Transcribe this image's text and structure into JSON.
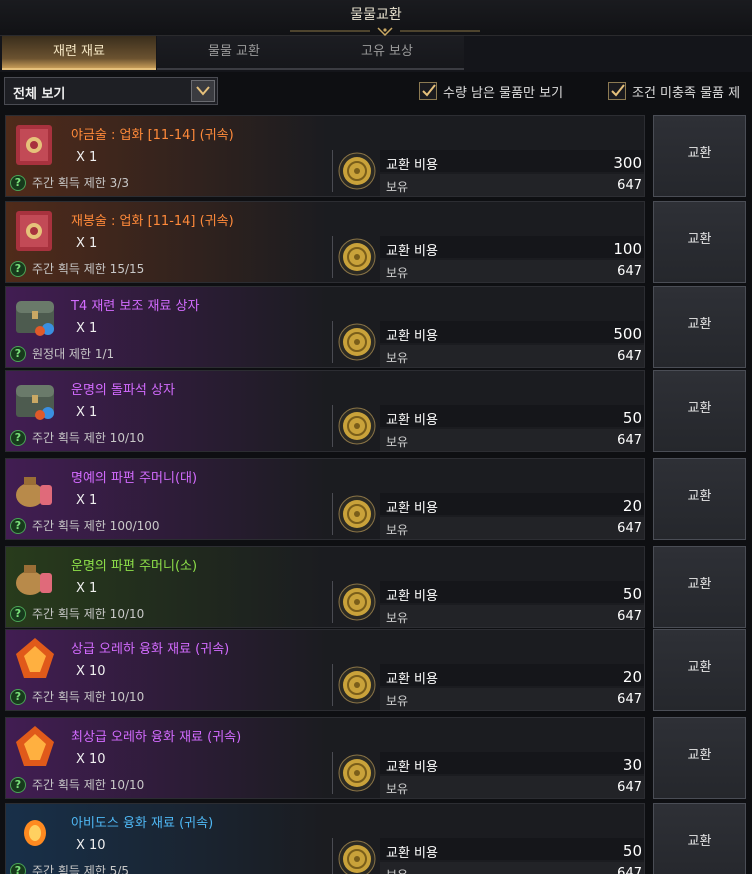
{
  "window": {
    "title": "물물교환"
  },
  "tabs": [
    {
      "label": "재련 재료",
      "active": true
    },
    {
      "label": "물물 교환",
      "active": false
    },
    {
      "label": "고유 보상",
      "active": false
    }
  ],
  "filter": {
    "dropdown_value": "전체 보기",
    "check_remaining": {
      "label": "수량 남은 물품만 보기",
      "checked": true
    },
    "check_unmet": {
      "label": "조건 미충족 물품 제",
      "checked": true
    }
  },
  "labels": {
    "cost": "교환 비용",
    "owned": "보유",
    "exchange": "교환"
  },
  "items": [
    {
      "name": "야금술 : 업화 [11-14] (귀속)",
      "grade": "orange",
      "qty": "X 1",
      "limit": "주간 획득 제한 3/3",
      "cost": "300",
      "owned": "647",
      "icon": "book-icon"
    },
    {
      "name": "재봉술 : 업화 [11-14] (귀속)",
      "grade": "orange",
      "qty": "X 1",
      "limit": "주간 획득 제한 15/15",
      "cost": "100",
      "owned": "647",
      "icon": "book-icon"
    },
    {
      "name": "T4 재련 보조 재료 상자",
      "grade": "purple",
      "qty": "X 1",
      "limit": "원정대 제한 1/1",
      "cost": "500",
      "owned": "647",
      "icon": "chest-icon"
    },
    {
      "name": "운명의 돌파석 상자",
      "grade": "purple",
      "qty": "X 1",
      "limit": "주간 획득 제한 10/10",
      "cost": "50",
      "owned": "647",
      "icon": "chest-icon"
    },
    {
      "name": "명예의 파편 주머니(대)",
      "grade": "purple",
      "qty": "X 1",
      "limit": "주간 획득 제한 100/100",
      "cost": "20",
      "owned": "647",
      "icon": "pouch-icon"
    },
    {
      "name": "운명의 파편 주머니(소)",
      "grade": "green",
      "qty": "X 1",
      "limit": "주간 획득 제한 10/10",
      "cost": "50",
      "owned": "647",
      "icon": "pouch-icon"
    },
    {
      "name": "상급 오레하 융화 재료 (귀속)",
      "grade": "purple",
      "qty": "X 10",
      "limit": "주간 획득 제한 10/10",
      "cost": "20",
      "owned": "647",
      "icon": "crystal-icon"
    },
    {
      "name": "최상급 오레하 융화 재료 (귀속)",
      "grade": "purple",
      "qty": "X 10",
      "limit": "주간 획득 제한 10/10",
      "cost": "30",
      "owned": "647",
      "icon": "crystal-icon"
    },
    {
      "name": "아비도스 융화 재료 (귀속)",
      "grade": "blue",
      "qty": "X 10",
      "limit": "주간 획득 제한 5/5",
      "cost": "50",
      "owned": "647",
      "icon": "gem-icon"
    }
  ]
}
